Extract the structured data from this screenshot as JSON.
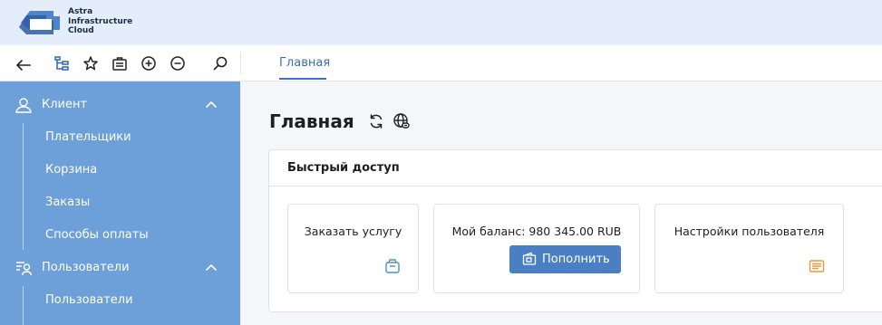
{
  "brand": {
    "line1": "Astra",
    "line2": "Infrastructure",
    "line3": "Cloud"
  },
  "toolbar": {
    "icons": [
      "back-arrow-icon",
      "tree-structure-icon",
      "star-icon",
      "briefcase-icon",
      "plus-circle-icon",
      "minus-circle-icon",
      "search-icon"
    ]
  },
  "tabs": [
    {
      "label": "Главная",
      "active": true
    }
  ],
  "sidebar": {
    "groups": [
      {
        "label": "Клиент",
        "icon": "user-icon",
        "expanded": true,
        "items": [
          "Плательщики",
          "Корзина",
          "Заказы",
          "Способы оплаты"
        ]
      },
      {
        "label": "Пользователи",
        "icon": "users-list-icon",
        "expanded": true,
        "items": [
          "Пользователи"
        ]
      }
    ]
  },
  "main": {
    "title": "Главная",
    "panel_title": "Быстрый доступ",
    "cards": [
      {
        "title": "Заказать услугу",
        "icon": "shopping-bag-icon"
      },
      {
        "title": "Мой баланс: 980 345.00 RUB",
        "button_label": "Пополнить",
        "button_icon": "wallet-icon"
      },
      {
        "title": "Настройки пользователя",
        "icon": "settings-list-icon"
      }
    ]
  },
  "colors": {
    "header_bg": "#e4eefb",
    "sidebar_bg": "#6d9fd9",
    "accent": "#3b74c7",
    "button_bg": "#4b7fc3",
    "card_icon_blue": "#4a90c8",
    "card_icon_orange": "#e69a3b"
  }
}
